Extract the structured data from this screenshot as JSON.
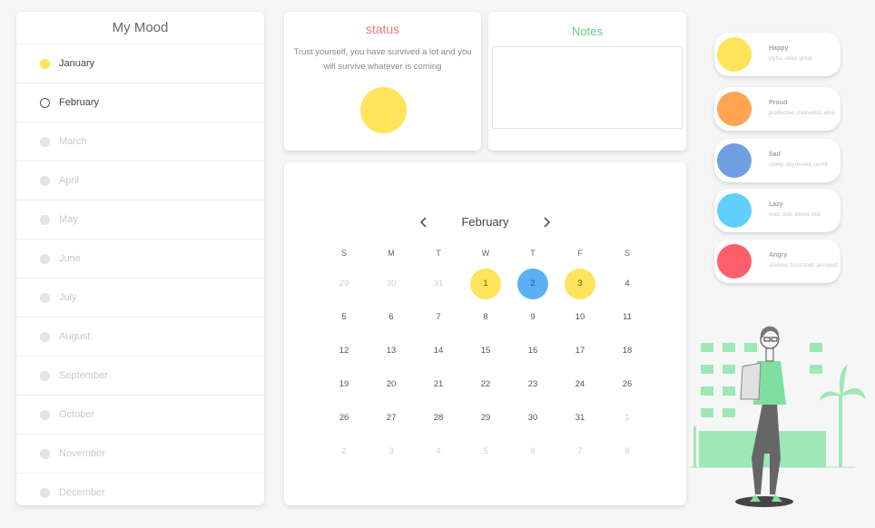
{
  "mood_panel": {
    "title": "My Mood",
    "months": [
      {
        "label": "January",
        "state": "done"
      },
      {
        "label": "February",
        "state": "current"
      },
      {
        "label": "March",
        "state": "future"
      },
      {
        "label": "April",
        "state": "future"
      },
      {
        "label": "May",
        "state": "future"
      },
      {
        "label": "June",
        "state": "future"
      },
      {
        "label": "July",
        "state": "future"
      },
      {
        "label": "August",
        "state": "future"
      },
      {
        "label": "September",
        "state": "future"
      },
      {
        "label": "October",
        "state": "future"
      },
      {
        "label": "November",
        "state": "future"
      },
      {
        "label": "December",
        "state": "future"
      }
    ]
  },
  "status": {
    "title": "status",
    "quote": "Trust yourself, you have survived a lot and you will survive whatever is coming",
    "mood_color": "#ffe45c"
  },
  "notes": {
    "title": "Notes",
    "value": ""
  },
  "calendar": {
    "month": "February",
    "prev_icon": "chevron-left-icon",
    "next_icon": "chevron-right-icon",
    "weekdays": [
      "S",
      "M",
      "T",
      "W",
      "T",
      "F",
      "S"
    ],
    "days": [
      {
        "d": "29",
        "muted": true
      },
      {
        "d": "30",
        "muted": true
      },
      {
        "d": "31",
        "muted": true
      },
      {
        "d": "1",
        "mood": "happy"
      },
      {
        "d": "2",
        "mood": "sad"
      },
      {
        "d": "3",
        "mood": "happy"
      },
      {
        "d": "4"
      },
      {
        "d": "5"
      },
      {
        "d": "6"
      },
      {
        "d": "7"
      },
      {
        "d": "8"
      },
      {
        "d": "9"
      },
      {
        "d": "10"
      },
      {
        "d": "11"
      },
      {
        "d": "12"
      },
      {
        "d": "13"
      },
      {
        "d": "14"
      },
      {
        "d": "15"
      },
      {
        "d": "16"
      },
      {
        "d": "17"
      },
      {
        "d": "18"
      },
      {
        "d": "19"
      },
      {
        "d": "20"
      },
      {
        "d": "21"
      },
      {
        "d": "22"
      },
      {
        "d": "23"
      },
      {
        "d": "24"
      },
      {
        "d": "26"
      },
      {
        "d": "26"
      },
      {
        "d": "27"
      },
      {
        "d": "28"
      },
      {
        "d": "29"
      },
      {
        "d": "30"
      },
      {
        "d": "31"
      },
      {
        "d": "1",
        "muted": true
      },
      {
        "d": "2",
        "muted": true
      },
      {
        "d": "3",
        "muted": true
      },
      {
        "d": "4",
        "muted": true
      },
      {
        "d": "5",
        "muted": true
      },
      {
        "d": "6",
        "muted": true
      },
      {
        "d": "7",
        "muted": true
      },
      {
        "d": "8",
        "muted": true
      }
    ]
  },
  "legend": [
    {
      "name": "Happy",
      "desc": "joyful, relax, great",
      "color": "#ffe45c"
    },
    {
      "name": "Proud",
      "desc": "productive, motivated, alive",
      "color": "#ffa552"
    },
    {
      "name": "Sad",
      "desc": "lonely, depressed, numb",
      "color": "#6f9fe0"
    },
    {
      "name": "Lazy",
      "desc": "tired, sick, bored, dull",
      "color": "#5fd0fc"
    },
    {
      "name": "Angry",
      "desc": "anxious, frustrated, annoyed",
      "color": "#ff5e6c"
    }
  ],
  "illustration": {
    "icon": "woman-with-backpack-illustration",
    "accent": "#7ee0a0"
  }
}
